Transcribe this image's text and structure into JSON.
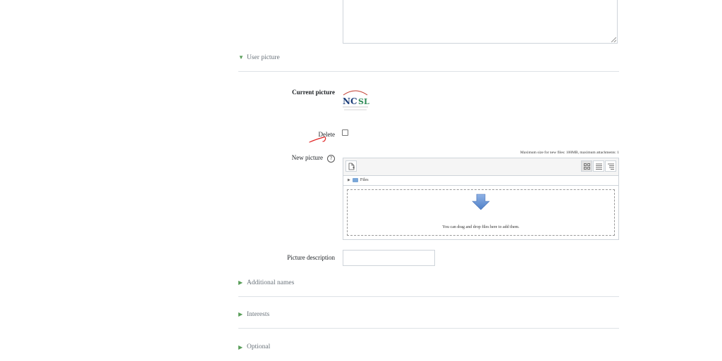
{
  "sections": {
    "user_picture": "User picture",
    "additional_names": "Additional names",
    "interests": "Interests",
    "optional": "Optional"
  },
  "fields": {
    "current_picture": "Current picture",
    "delete": "Delete",
    "new_picture": "New picture",
    "help_glyph": "?",
    "picture_description": "Picture description",
    "description_value": ""
  },
  "filepicker": {
    "max_size": "Maximum size for new files: 100MB, maximum attachments: 1",
    "path_folder": "Files",
    "drop_text": "You can drag and drop files here to add them."
  },
  "colors": {
    "section_caret": "#5a9e5a",
    "annotation": "#e02020",
    "arrow_fill": "#6d96d4"
  },
  "icons": {
    "section_open": "triangle-down",
    "section_closed": "triangle-right",
    "add_file": "document-add-icon",
    "views": [
      "grid-view-icon",
      "list-view-icon",
      "tree-view-icon"
    ],
    "drop": "arrow-down-icon"
  }
}
